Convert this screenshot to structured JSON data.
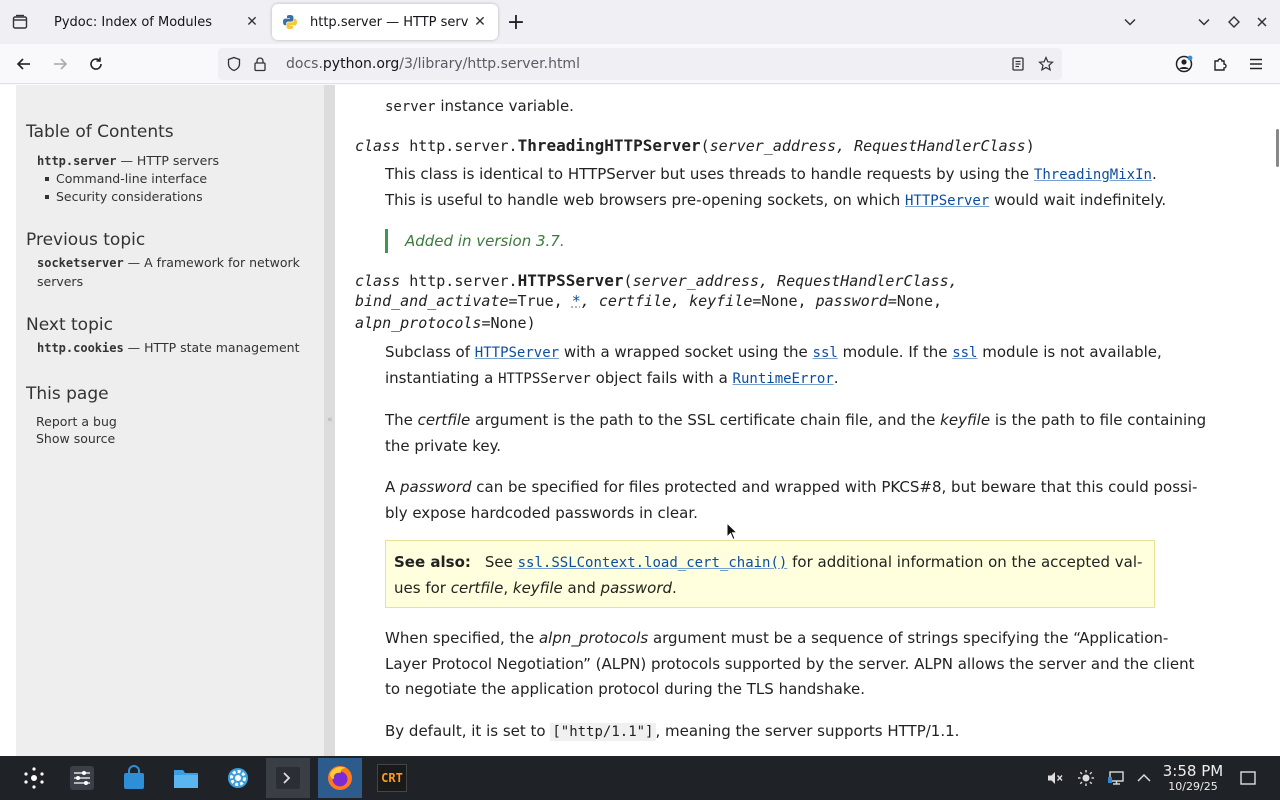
{
  "browser": {
    "tabs": [
      {
        "title": "Pydoc: Index of Modules",
        "active": false
      },
      {
        "title": "http.server — HTTP server",
        "active": true
      }
    ],
    "url_prefix": "docs.",
    "url_host": "python.org",
    "url_path": "/3/library/http.server.html"
  },
  "sidebar": {
    "toc_heading": "Table of Contents",
    "toc_module": "http.server",
    "toc_module_desc": " — HTTP servers",
    "toc_items": [
      "Command-line interface",
      "Security considerations"
    ],
    "prev_heading": "Previous topic",
    "prev_module": "socketserver",
    "prev_desc_1": " — A framework for network",
    "prev_desc_2": "servers",
    "next_heading": "Next topic",
    "next_module": "http.cookies",
    "next_desc": " — HTTP state management",
    "thispage_heading": "This page",
    "report_bug": "Report a bug",
    "show_source": "Show source"
  },
  "content": {
    "top_line_code": "server",
    "top_line_text": " instance variable.",
    "threading_sig": {
      "kw": "class ",
      "prefix": "http.server.",
      "name": "ThreadingHTTPServer",
      "params": "server_address, RequestHandlerClass"
    },
    "threading_p1_a": "This class is identical to HTTPServer but uses threads to handle requests by using the ",
    "threading_p1_link": "ThreadingMixIn",
    "threading_p1_b": ".",
    "threading_p2_a": "This is useful to handle web browsers pre-opening sockets, on which ",
    "threading_p2_link": "HTTPServer",
    "threading_p2_b": " would wait indefinitely.",
    "version_added": "Added in version 3.7.",
    "https_sig": {
      "kw": "class ",
      "prefix": "http.server.",
      "name": "HTTPSServer",
      "line1_params": "server_address, RequestHandlerClass,",
      "line2_a": "bind_and_activate",
      "line2_b": "=True, ",
      "line2_star": "*",
      "line2_c": ", certfile, keyfile",
      "line2_d": "=None, ",
      "line2_e": "password",
      "line2_f": "=None,",
      "line3_a": "alpn_protocols",
      "line3_b": "=None"
    },
    "sub_p1_a": "Subclass of ",
    "sub_p1_link1": "HTTPServer",
    "sub_p1_b": " with a wrapped socket using the ",
    "sub_p1_link2": "ssl",
    "sub_p1_c": " module. If the ",
    "sub_p1_link3": "ssl",
    "sub_p1_d": " module is not available,",
    "sub_p2_a": "instantiating a ",
    "sub_p2_code": "HTTPSServer",
    "sub_p2_b": " object fails with a ",
    "sub_p2_link": "RuntimeError",
    "sub_p2_c": ".",
    "cert_p1_a": "The ",
    "cert_p1_em1": "certfile",
    "cert_p1_b": " argument is the path to the SSL certificate chain file, and the ",
    "cert_p1_em2": "keyfile",
    "cert_p1_c": " is the path to file containing",
    "cert_p2": "the private key.",
    "pw_p1_a": "A ",
    "pw_p1_em": "password",
    "pw_p1_b": " can be specified for files protected and wrapped with PKCS#8, but beware that this could possi-",
    "pw_p2": "bly expose hardcoded passwords in clear.",
    "seealso_label": "See also:",
    "seealso_a": "See ",
    "seealso_link": "ssl.SSLContext.load_cert_chain()",
    "seealso_b": " for additional information on the accepted val-",
    "seealso_c": "ues for ",
    "seealso_em1": "certfile",
    "seealso_d": ", ",
    "seealso_em2": "keyfile",
    "seealso_e": " and ",
    "seealso_em3": "password",
    "seealso_f": ".",
    "alpn_p1_a": "When specified, the ",
    "alpn_p1_em": "alpn_protocols",
    "alpn_p1_b": " argument must be a sequence of strings specifying the “Application-",
    "alpn_p2": "Layer Protocol Negotiation” (ALPN) protocols supported by the server. ALPN allows the server and the client",
    "alpn_p3": "to negotiate the application protocol during the TLS handshake.",
    "default_a": "By default, it is set to ",
    "default_code": "[\"http/1.1\"]",
    "default_b": ", meaning the server supports HTTP/1.1."
  },
  "taskbar": {
    "time": "3:58 PM",
    "date": "10/29/25",
    "crt_label": "CRT"
  },
  "colors": {
    "link": "#0a4ea3",
    "seealso_bg": "#ffffdd",
    "versionadded_border": "#3c9a4a",
    "taskbar_bg": "#1f2328"
  }
}
